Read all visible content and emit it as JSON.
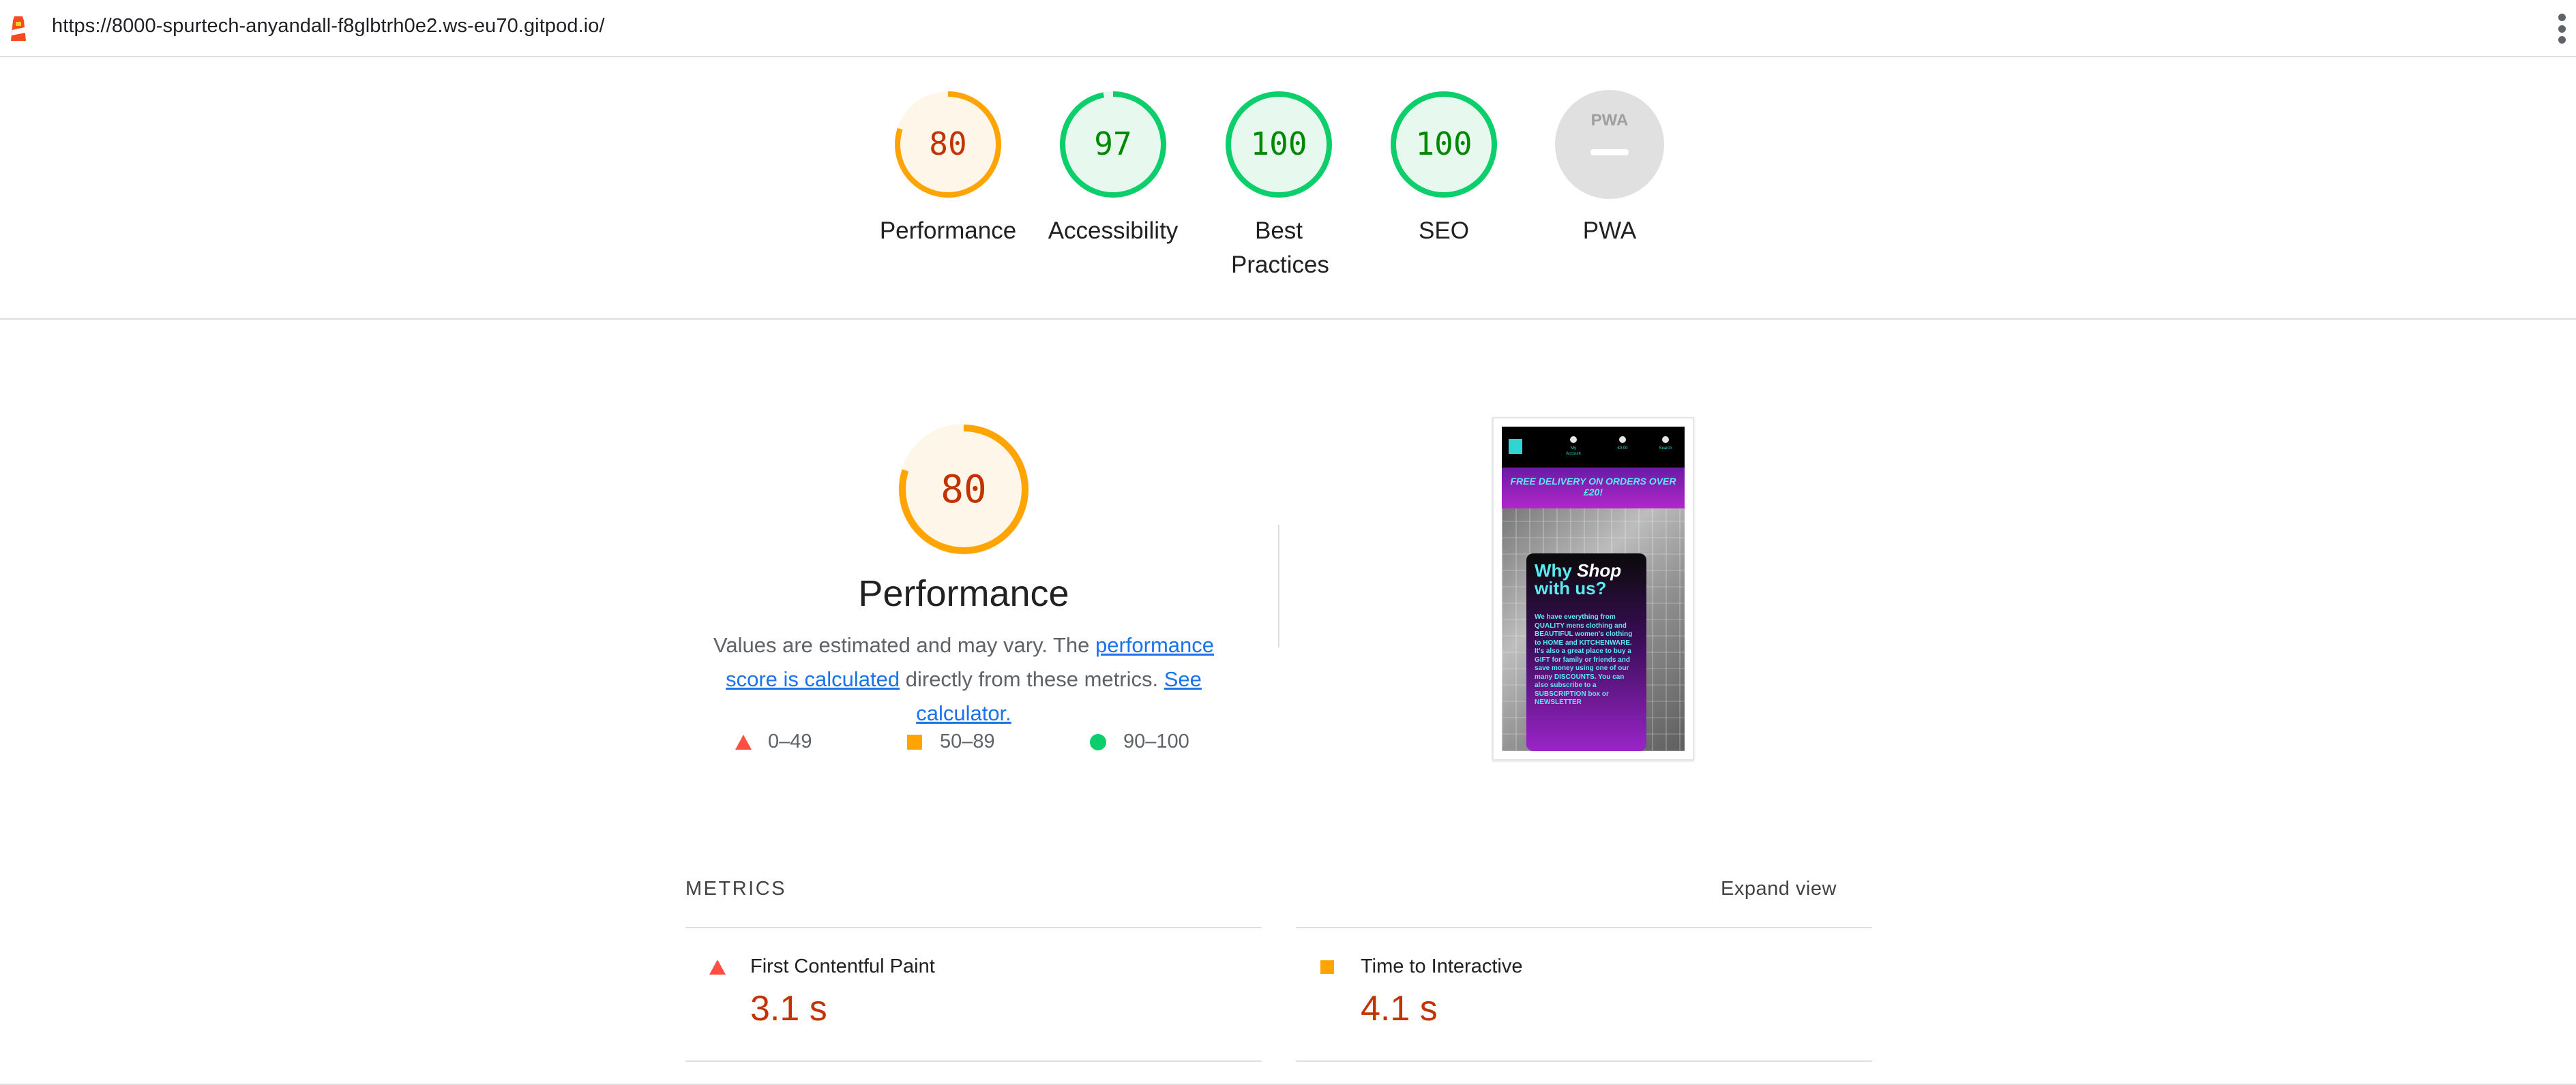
{
  "browser": {
    "url": "https://8000-spurtech-anyandall-f8glbtrh0e2.ws-eu70.gitpod.io/"
  },
  "categories": [
    {
      "label": "Performance",
      "score": "80",
      "value": 80,
      "status": "average"
    },
    {
      "label": "Accessibility",
      "score": "97",
      "value": 97,
      "status": "pass"
    },
    {
      "label": "Best Practices",
      "score": "100",
      "value": 100,
      "status": "pass"
    },
    {
      "label": "SEO",
      "score": "100",
      "value": 100,
      "status": "pass"
    },
    {
      "label": "PWA",
      "score": "",
      "value": null,
      "status": "na",
      "badge_text": "PWA"
    }
  ],
  "performance": {
    "score": "80",
    "value": 80,
    "title": "Performance",
    "desc_prefix": "Values are estimated and may vary. The ",
    "desc_link1": "performance score is calculated",
    "desc_middle": " directly from these metrics. ",
    "desc_link2": "See calculator.",
    "legend": [
      {
        "shape": "triangle",
        "range": "0–49"
      },
      {
        "shape": "square",
        "range": "50–89"
      },
      {
        "shape": "circle",
        "range": "90–100"
      }
    ]
  },
  "screenshot": {
    "nav_labels": [
      "My Account",
      "£0.00",
      "Search"
    ],
    "banner": "FREE DELIVERY ON ORDERS OVER £20!",
    "card_title_a": "Why ",
    "card_title_b": "Shop",
    "card_title_c": " with us?",
    "card_body": "We have everything from QUALITY mens clothing and BEAUTIFUL women's clothing to HOME and KITCHENWARE. It's also a great place to buy a GIFT for family or friends and save money using one of our many DISCOUNTS. You can also subscribe to a SUBSCRIPTION box or NEWSLETTER"
  },
  "metrics": {
    "heading": "METRICS",
    "expand_label": "Expand view",
    "items": [
      {
        "name": "First Contentful Paint",
        "value": "3.1 s",
        "status": "fail"
      },
      {
        "name": "Time to Interactive",
        "value": "4.1 s",
        "status": "average"
      }
    ]
  },
  "colors": {
    "pass": "#0cce6b",
    "pass_text": "#008800",
    "average": "#ffa400",
    "average_text": "#c33300",
    "fail": "#ff4e42",
    "na": "#e0e0e0",
    "link": "#1a73e8"
  }
}
